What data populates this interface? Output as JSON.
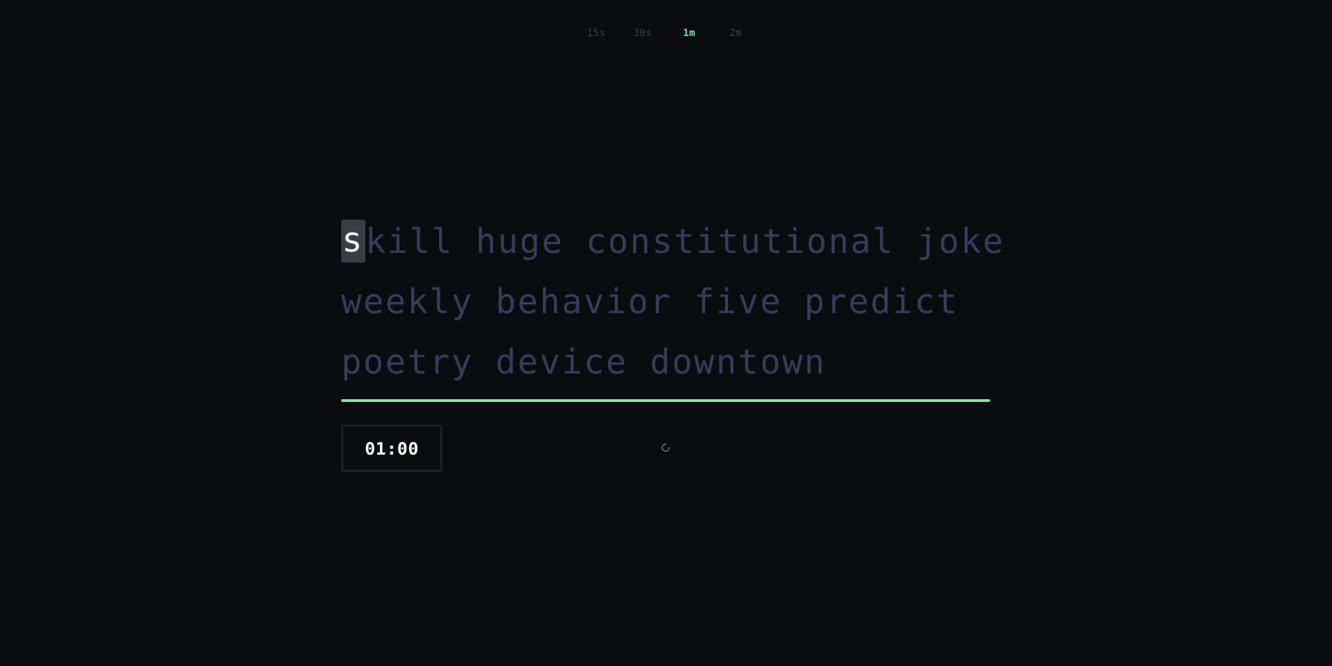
{
  "durations": {
    "options": [
      "15s",
      "30s",
      "1m",
      "2m"
    ],
    "selected": "1m"
  },
  "words": {
    "current_char": "s",
    "line1_rest": "kill huge constitutional joke",
    "line2": "weekly behavior five predict",
    "line3": "poetry device downtown"
  },
  "progress": {
    "fraction": 1.0
  },
  "timer": {
    "value": "01:00"
  },
  "icons": {
    "restart": "restart-icon"
  },
  "colors": {
    "accent": "#86e3a7",
    "untyped_text": "#3c3a5c",
    "background": "#0b0c10"
  }
}
